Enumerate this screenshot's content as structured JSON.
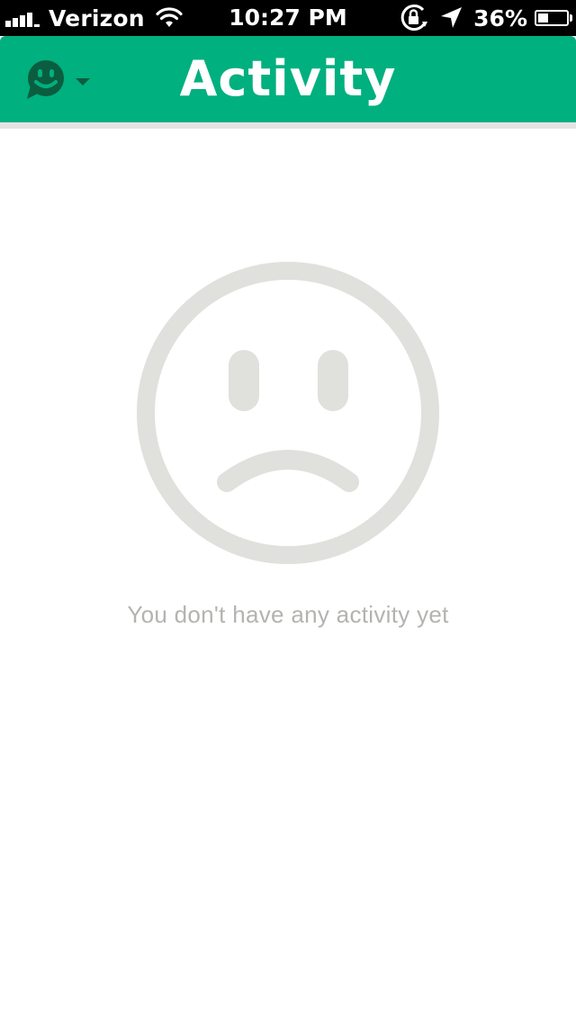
{
  "status_bar": {
    "carrier": "Verizon",
    "time": "10:27 PM",
    "battery_percent": "36%",
    "battery_level": 0.36,
    "icons": [
      "signal-icon",
      "wifi-icon",
      "rotation-lock-icon",
      "location-arrow-icon",
      "battery-icon"
    ]
  },
  "nav": {
    "title": "Activity",
    "menu_icon": "chat-smiley-icon",
    "menu_caret": "caret-down-icon"
  },
  "empty_state": {
    "icon": "sad-face-icon",
    "message": "You don't have any activity yet"
  },
  "colors": {
    "accent": "#00b07f",
    "icon_dark": "#0b5d3f",
    "empty_icon": "#e0e0dc",
    "empty_text": "#b3b3b0"
  }
}
